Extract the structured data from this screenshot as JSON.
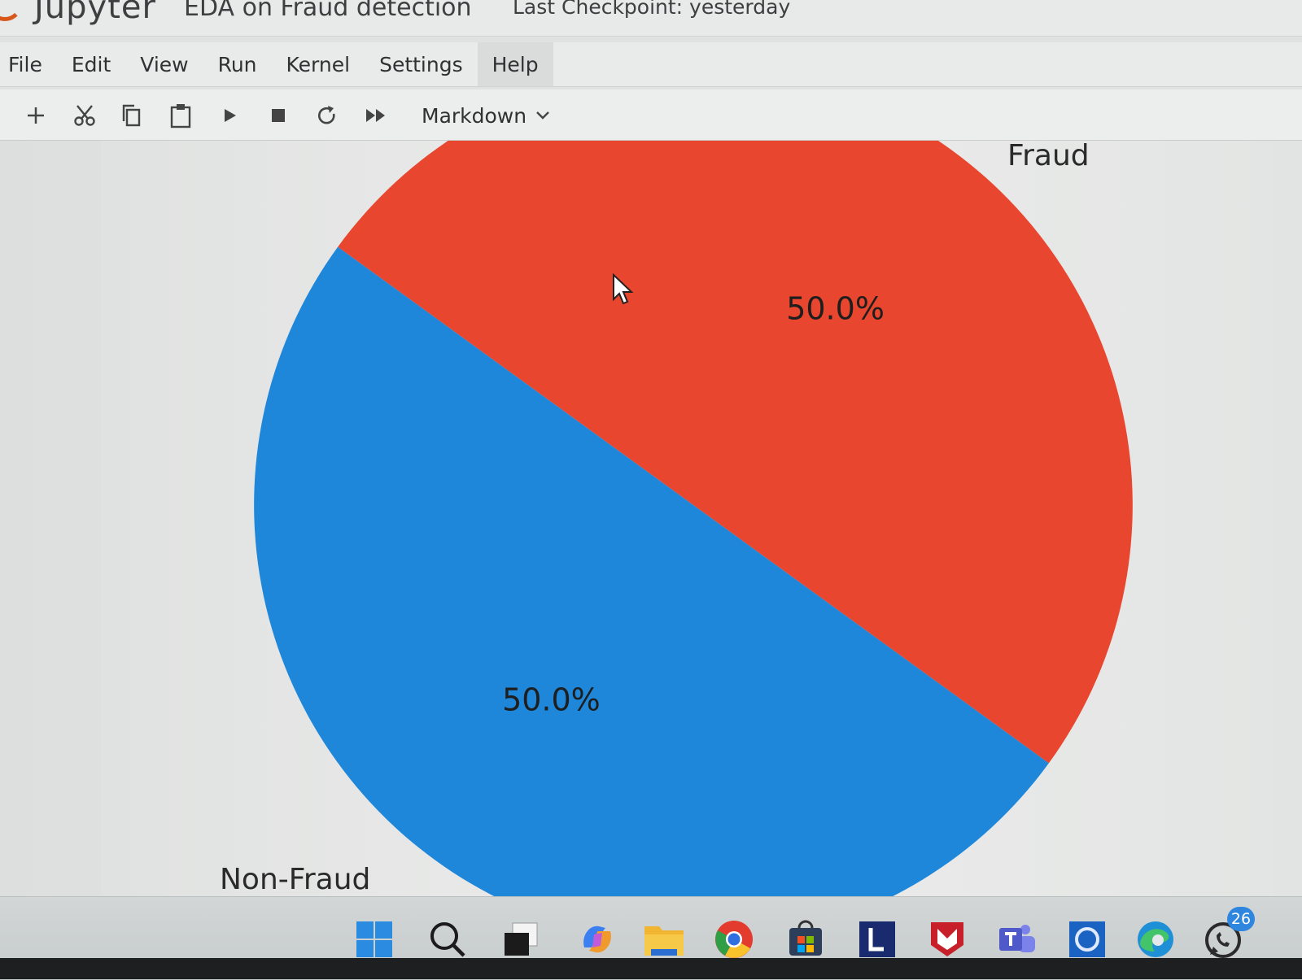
{
  "app": {
    "name": "Jupyter",
    "notebook_title": "EDA on Fraud detection",
    "checkpoint": "Last Checkpoint: yesterday"
  },
  "menu": [
    "File",
    "Edit",
    "View",
    "Run",
    "Kernel",
    "Settings",
    "Help"
  ],
  "toolbar": {
    "buttons": [
      "add-cell",
      "cut",
      "copy",
      "paste",
      "run",
      "stop",
      "restart",
      "run-all"
    ],
    "cell_type": "Markdown"
  },
  "chart_data": {
    "type": "pie",
    "labels": [
      "Fraud",
      "Non-Fraud"
    ],
    "values": [
      50.0,
      50.0
    ],
    "pct_labels": [
      "50.0%",
      "50.0%"
    ],
    "colors": [
      "#e8462e",
      "#1f87da"
    ]
  },
  "taskbar": {
    "icons": [
      "windows-start",
      "search",
      "task-view",
      "copilot",
      "file-explorer",
      "chrome",
      "microsoft-store",
      "lenovo-vantage",
      "mcafee",
      "teams",
      "cortana",
      "edge",
      "whatsapp"
    ],
    "whatsapp_badge": "26"
  }
}
